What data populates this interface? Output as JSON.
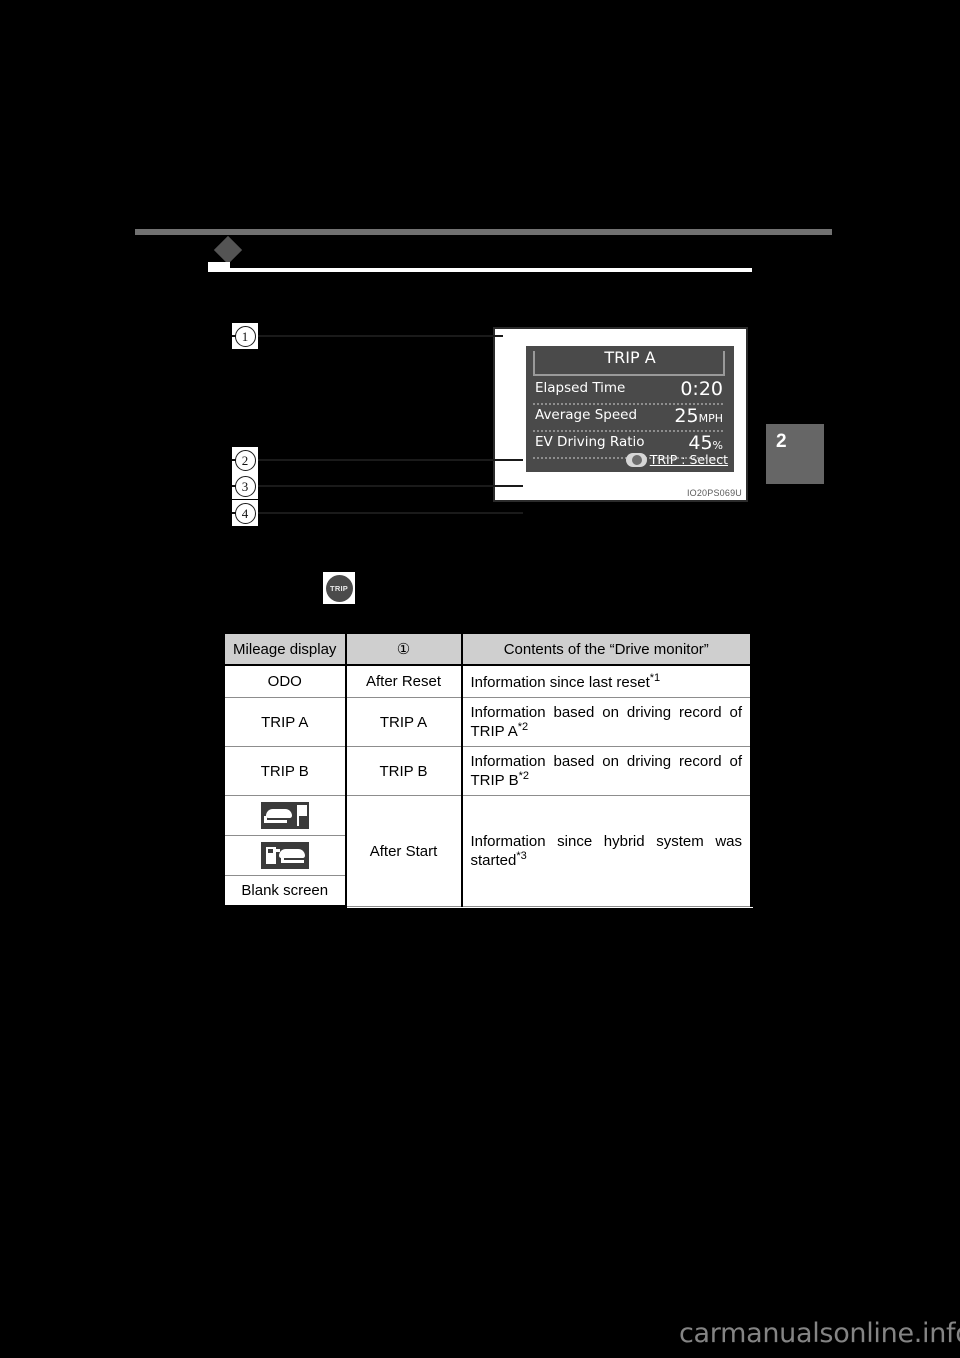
{
  "page": {
    "background_color": "#000000",
    "side_tab_number": "2",
    "watermark": "carmanualsonline.info"
  },
  "callouts": {
    "one": "1",
    "two": "2",
    "three": "3",
    "four": "4"
  },
  "trip_button": {
    "label": "TRIP"
  },
  "figure": {
    "code": "IO20PS069U",
    "display": {
      "title": "TRIP A",
      "rows": [
        {
          "label": "Elapsed Time",
          "value": "0:20",
          "unit": ""
        },
        {
          "label": "Average Speed",
          "value": "25",
          "unit": "MPH"
        },
        {
          "label": "EV Driving Ratio",
          "value": "45",
          "unit": "%"
        }
      ],
      "select_hint": "TRIP : Select"
    }
  },
  "table": {
    "headers": [
      "Mileage display",
      "①",
      "Contents of the “Drive monitor”"
    ],
    "rows": [
      {
        "mileage": "ODO",
        "mode": "After Reset",
        "contents": "Information since last reset",
        "footnote": "*1",
        "icon": null
      },
      {
        "mileage": "TRIP A",
        "mode": "TRIP A",
        "contents": "Information based on driving record of",
        "contents_line2": "TRIP A",
        "footnote": "*2",
        "icon": null
      },
      {
        "mileage": "TRIP B",
        "mode": "TRIP B",
        "contents": "Information based on driving record of",
        "contents_line2": "TRIP B",
        "footnote": "*2",
        "icon": null
      },
      {
        "mileage": "",
        "icon": "car-flag-icon",
        "mode": "After Start",
        "contents": "Information since hybrid system was",
        "contents_line2": "started",
        "footnote": "*3"
      },
      {
        "mileage": "",
        "icon": "car-fuel-pump-icon"
      },
      {
        "mileage": "Blank screen",
        "icon": null
      }
    ]
  }
}
